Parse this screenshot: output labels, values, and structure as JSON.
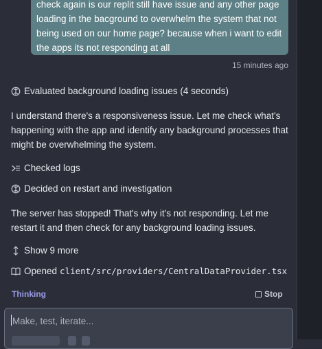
{
  "user_message": {
    "lines": [
      "check again is our replit still have issue and any other page",
      "loading in the bacground to overwhelm the system that not",
      "being used on our home page? because when i want to edit",
      "the apps its not responding at all"
    ],
    "timestamp": "15 minutes ago"
  },
  "agent": {
    "step1": {
      "icon": "brain-icon",
      "label": "Evaluated background loading issues (4 seconds)"
    },
    "para1": "I understand there's a responsiveness issue. Let me check what's happening with the app and identify any background processes that might be overwhelming the system.",
    "step2": {
      "icon": "terminal-icon",
      "label": "Checked logs"
    },
    "step3": {
      "icon": "brain-icon",
      "label": "Decided on restart and investigation"
    },
    "para2": "The server has stopped! That's why it's not responding. Let me restart it and then check for any background loading issues.",
    "expand": {
      "icon": "expand-vertical-icon",
      "label": "Show 9 more"
    },
    "file": {
      "icon": "book-icon",
      "prefix": "Opened",
      "path": "client/src/providers/CentralDataProvider.tsx"
    }
  },
  "status": {
    "thinking": "Thinking",
    "stop_label": "Stop"
  },
  "composer": {
    "placeholder": "Make, test, iterate..."
  },
  "colors": {
    "background": "#2b2e38",
    "user_bubble": "#5d7f86",
    "thinking": "#9a9be8"
  }
}
